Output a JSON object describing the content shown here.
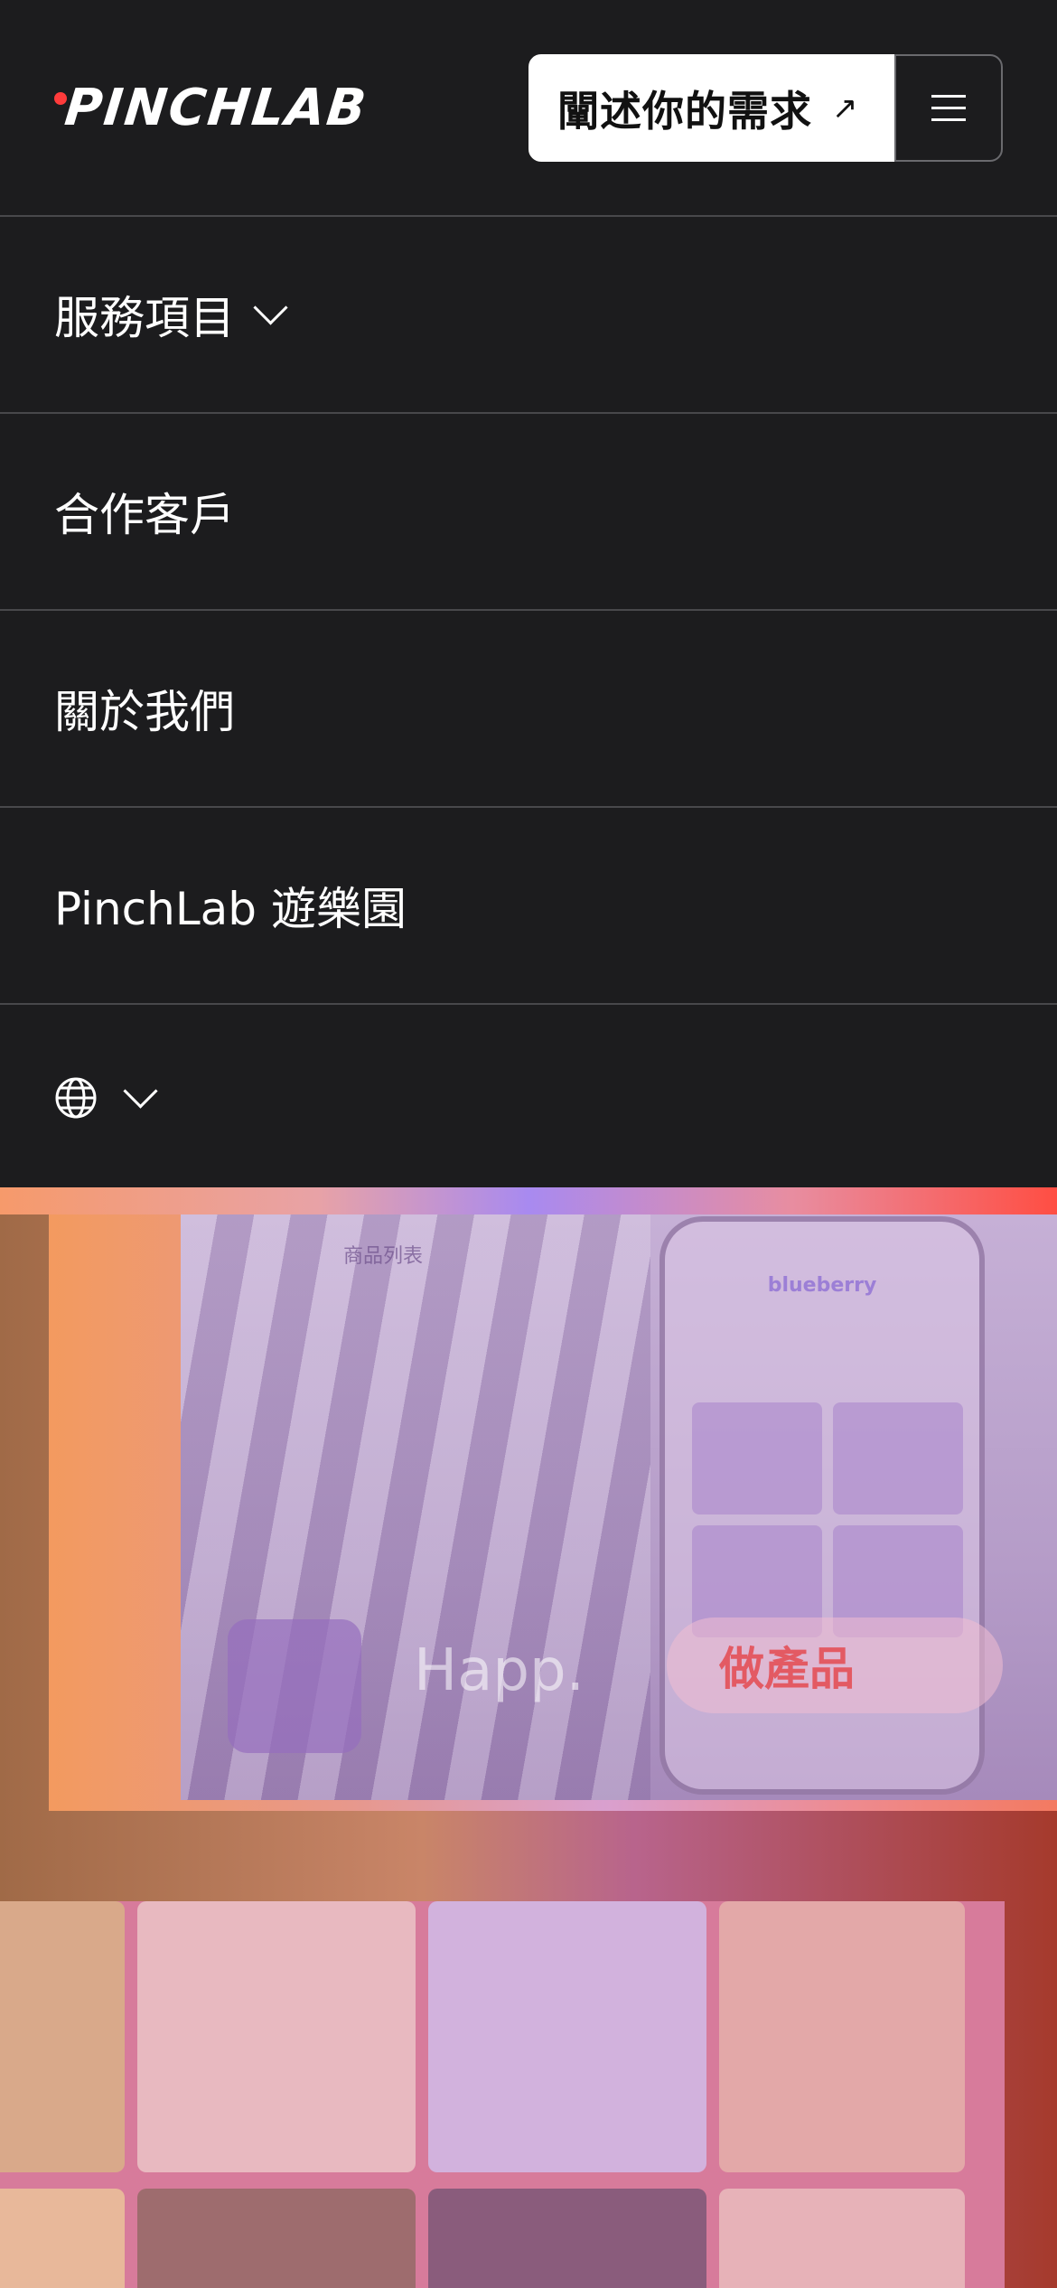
{
  "brand": {
    "logo_text": "PINCHLAB",
    "accent": "#ff3b3b"
  },
  "header": {
    "cta_label": "闡述你的需求",
    "cta_arrow": "↗",
    "menu_icon": "hamburger-icon"
  },
  "nav": {
    "items": [
      {
        "label": "服務項目",
        "has_dropdown": true
      },
      {
        "label": "合作客戶",
        "has_dropdown": false
      },
      {
        "label": "關於我們",
        "has_dropdown": false
      },
      {
        "label": "PinchLab 遊樂園",
        "has_dropdown": false
      }
    ],
    "language_icon": "globe-icon"
  },
  "hero": {
    "list_label": "商品列表",
    "phone_title": "blueberry",
    "happ_text": "Happ.",
    "pill_text": "做產品"
  }
}
